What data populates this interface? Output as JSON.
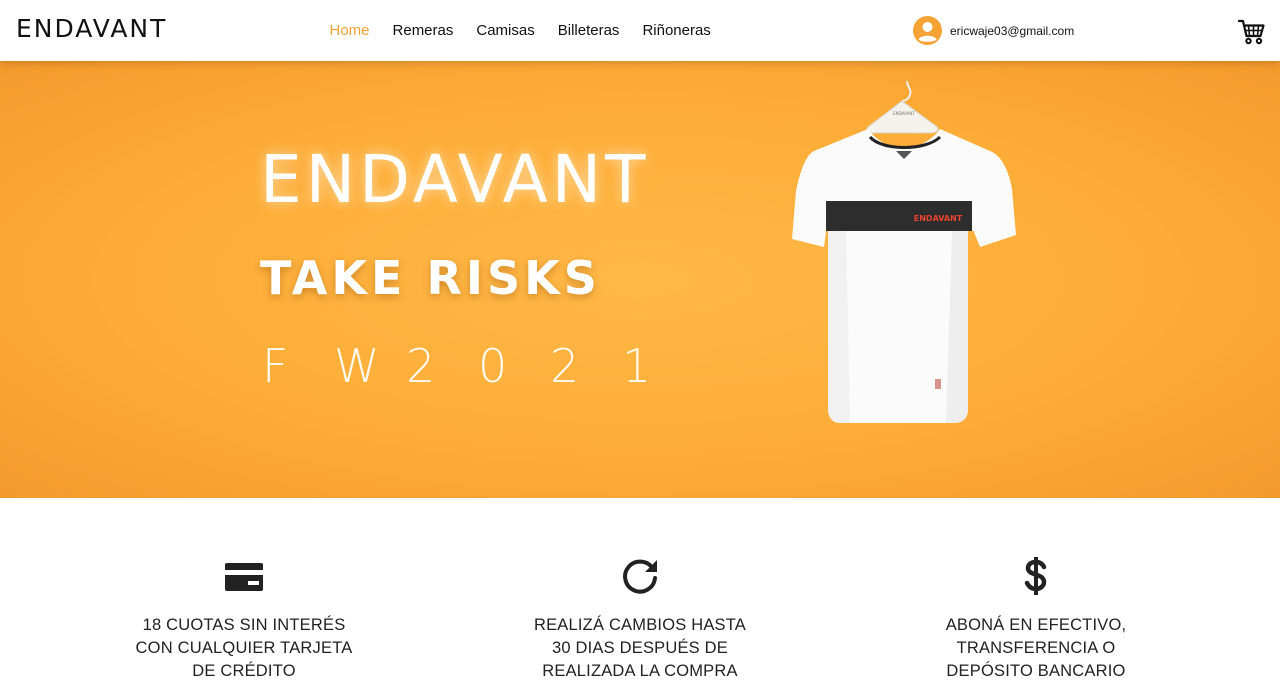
{
  "header": {
    "logo": "ENDAVANT",
    "nav": [
      {
        "label": "Home",
        "active": true
      },
      {
        "label": "Remeras",
        "active": false
      },
      {
        "label": "Camisas",
        "active": false
      },
      {
        "label": "Billeteras",
        "active": false
      },
      {
        "label": "Riñoneras",
        "active": false
      }
    ],
    "user_email": "ericwaje03@gmail.com",
    "user_icon": "user-circle-icon",
    "cart_icon": "cart-icon"
  },
  "hero": {
    "brand": "ENDAVANT",
    "tagline": "TAKE RISKS",
    "season": [
      "F",
      "W",
      "2",
      "0",
      "2",
      "1"
    ],
    "shirt_logo": "ENDAVANT",
    "shirt_tag": "ENDAVANT"
  },
  "features": [
    {
      "icon": "credit-card-icon",
      "lines": [
        "18 CUOTAS SIN INTERÉS",
        "CON CUALQUIER TARJETA",
        "DE CRÉDITO"
      ]
    },
    {
      "icon": "refresh-icon",
      "lines": [
        "REALIZÁ CAMBIOS HASTA",
        "30 DIAS DESPUÉS DE",
        "REALIZADA LA COMPRA"
      ]
    },
    {
      "icon": "dollar-icon",
      "lines": [
        "ABONÁ EN EFECTIVO,",
        "TRANSFERENCIA O",
        "DEPÓSITO BANCARIO"
      ]
    }
  ],
  "colors": {
    "accent": "#f7a234",
    "hero_bg": "#fdad38",
    "text": "#222222"
  }
}
